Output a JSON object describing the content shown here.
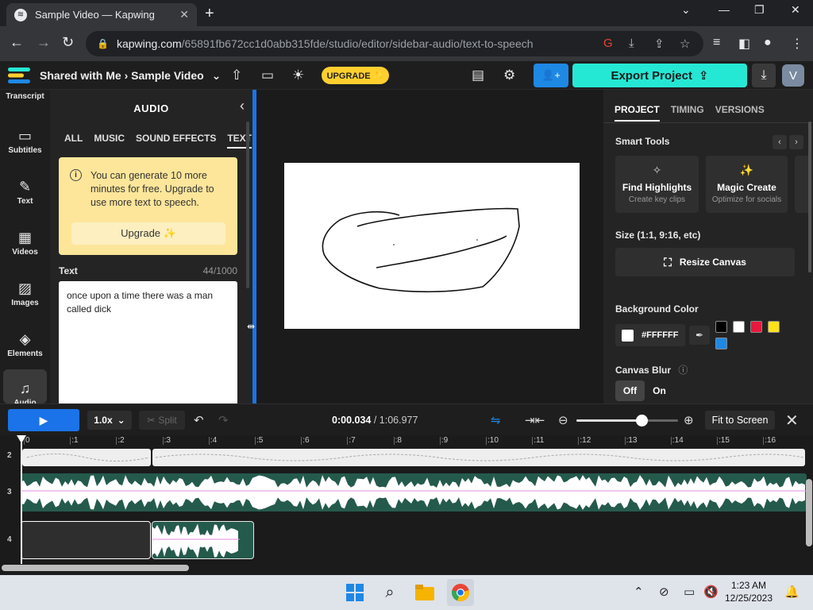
{
  "browser": {
    "tab_title": "Sample Video — Kapwing",
    "url_host": "kapwing.com",
    "url_path": "/65891fb672cc1d0abb315fde/studio/editor/sidebar-audio/text-to-speech"
  },
  "header": {
    "breadcrumb_parent": "Shared with Me",
    "breadcrumb_sep": "›",
    "project_title": "Sample Video",
    "upgrade_label": "UPGRADE ✨",
    "export_label": "Export Project",
    "avatar_letter": "V"
  },
  "rail": {
    "items": [
      {
        "label": "Transcript",
        "icon": "transcript-icon"
      },
      {
        "label": "Subtitles",
        "icon": "subtitles-icon"
      },
      {
        "label": "Text",
        "icon": "text-icon"
      },
      {
        "label": "Videos",
        "icon": "videos-icon"
      },
      {
        "label": "Images",
        "icon": "images-icon"
      },
      {
        "label": "Elements",
        "icon": "elements-icon"
      },
      {
        "label": "Audio",
        "icon": "audio-icon"
      }
    ]
  },
  "audio_panel": {
    "title": "AUDIO",
    "tabs": [
      "ALL",
      "MUSIC",
      "SOUND EFFECTS",
      "TEXT"
    ],
    "selected_tab": "TEXT",
    "info_message": "You can generate 10 more minutes for free. Upgrade to use more text to speech.",
    "upgrade_button": "Upgrade ✨",
    "text_label": "Text",
    "char_count": "44/1000",
    "text_value": "once upon a time there was a man called dick"
  },
  "right_panel": {
    "tabs": [
      "PROJECT",
      "TIMING",
      "VERSIONS"
    ],
    "smart_tools_heading": "Smart Tools",
    "tools": [
      {
        "name": "Find Highlights",
        "sub": "Create key clips"
      },
      {
        "name": "Magic Create",
        "sub": "Optimize for socials"
      }
    ],
    "size_heading": "Size (1:1, 9:16, etc)",
    "resize_label": "Resize Canvas",
    "bg_heading": "Background Color",
    "bg_hex": "#FFFFFF",
    "swatches": [
      "#000000",
      "#ffffff",
      "#e8193c",
      "#ffe11a",
      "#1e88e5"
    ],
    "blur_heading": "Canvas Blur",
    "blur_off": "Off",
    "blur_on": "On"
  },
  "timeline_toolbar": {
    "speed": "1.0x",
    "split_label": "Split",
    "current_time": "0:00.034",
    "total_time": "1:06.977",
    "time_sep": " / ",
    "fit_label": "Fit to Screen",
    "zoom_level": 0.64
  },
  "timeline": {
    "ticks": [
      "0",
      ":1",
      ":2",
      ":3",
      ":4",
      ":5",
      ":6",
      ":7",
      ":8",
      ":9",
      ":10",
      ":11",
      ":12",
      ":13",
      ":14",
      ":15",
      ":16"
    ],
    "rows": [
      "2",
      "3",
      "4"
    ]
  },
  "taskbar": {
    "time": "1:23 AM",
    "date": "12/25/2023"
  }
}
